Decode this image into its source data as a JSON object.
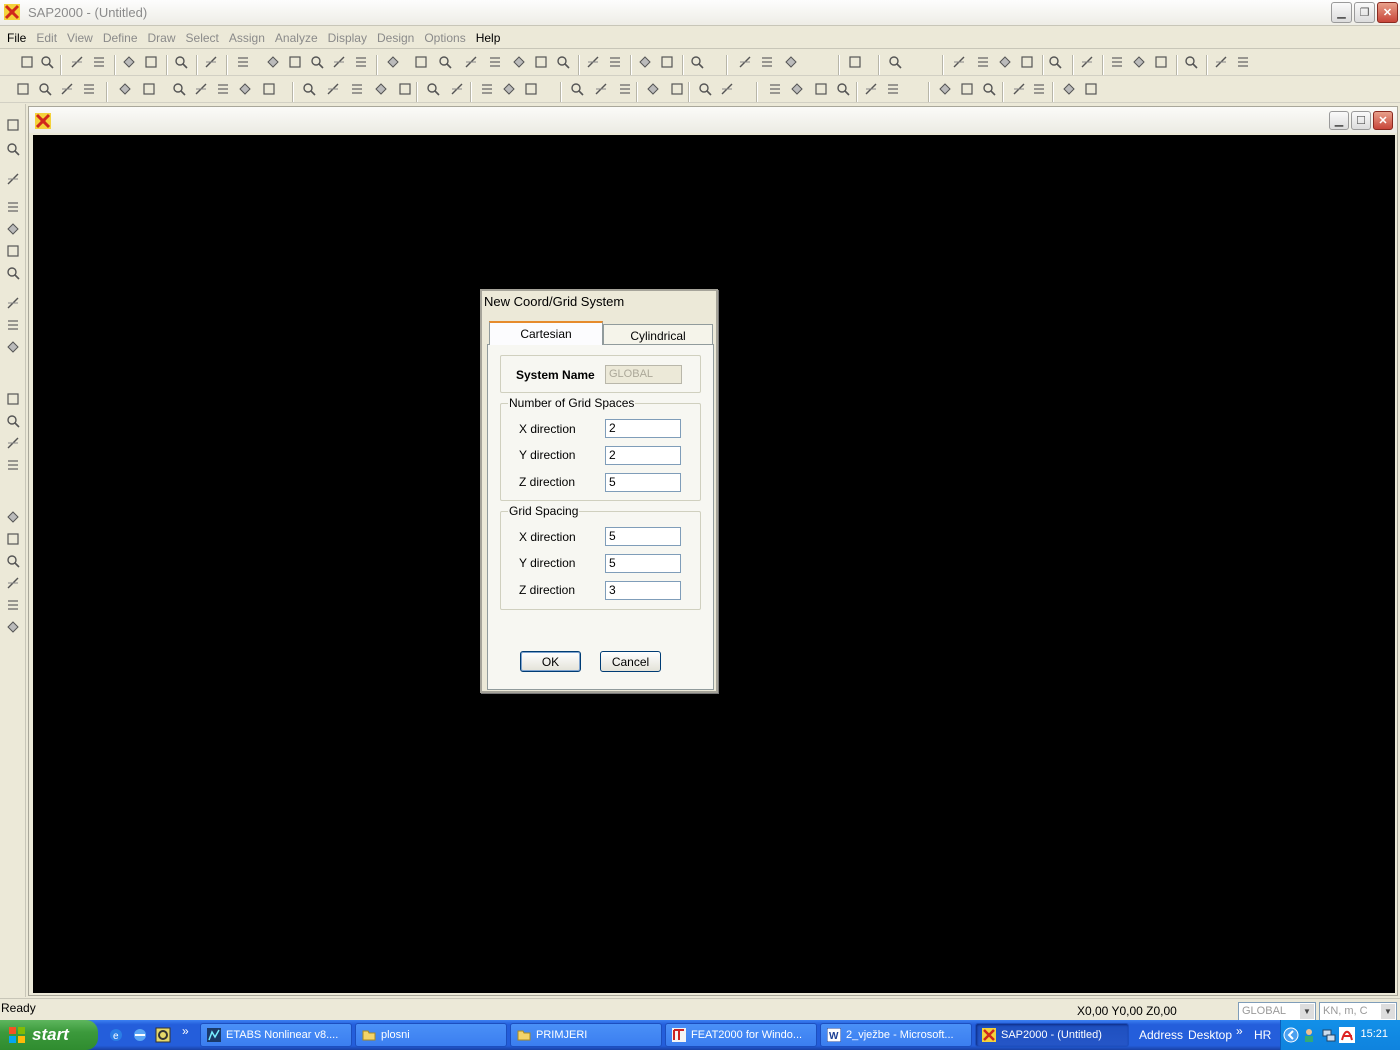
{
  "window": {
    "title": "SAP2000 - (Untitled)"
  },
  "menu": [
    "File",
    "Edit",
    "View",
    "Define",
    "Draw",
    "Select",
    "Assign",
    "Analyze",
    "Display",
    "Design",
    "Options",
    "Help"
  ],
  "dialog": {
    "title": "New Coord/Grid System",
    "tabs": [
      "Cartesian",
      "Cylindrical"
    ],
    "system_name_label": "System Name",
    "system_name_value": "GLOBAL",
    "grid_spaces": {
      "label": "Number of Grid Spaces",
      "x_label": "X direction",
      "x_value": "2",
      "y_label": "Y direction",
      "y_value": "2",
      "z_label": "Z direction",
      "z_value": "5"
    },
    "grid_spacing": {
      "label": "Grid Spacing",
      "x_label": "X direction",
      "x_value": "5",
      "y_label": "Y direction",
      "y_value": "5",
      "z_label": "Z direction",
      "z_value": "3"
    },
    "ok_label": "OK",
    "cancel_label": "Cancel"
  },
  "status": {
    "text": "Ready",
    "coords": "X0,00  Y0,00  Z0,00",
    "coord_system": "GLOBAL",
    "units": "KN, m, C"
  },
  "taskbar": {
    "start_label": "start",
    "more": "»",
    "tasks": [
      "ETABS Nonlinear v8....",
      "plosni",
      "PRIMJERI",
      "FEAT2000 for Windo...",
      "2_vježbe - Microsoft...",
      "SAP2000 - (Untitled)"
    ],
    "address_label": "Address",
    "desktop_label": "Desktop",
    "lang": "HR",
    "clock": "15:21"
  },
  "colors": {
    "canvas": "#000000",
    "taskbar": "#245edb",
    "start": "#3c9a3c"
  }
}
